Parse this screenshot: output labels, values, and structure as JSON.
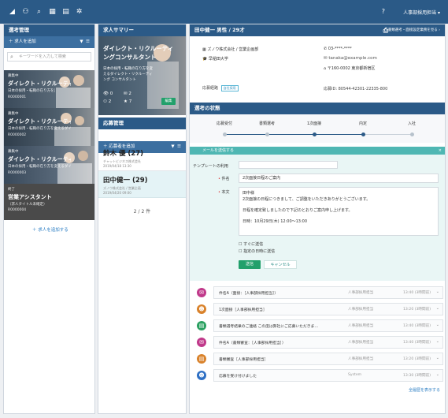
{
  "topbar": {
    "help_icon": "?",
    "user": "人事部採用担当 ▾"
  },
  "col1": {
    "title": "選考管理",
    "add_label": "＋ 求人を追加",
    "search_placeholder": "キーワードを入力して検索",
    "cards": [
      {
        "tag": "募集中",
        "title": "ダイレクト・リクルーティング",
        "sub": "日本の採用・転職の在り方を変える",
        "id": "R0000001"
      },
      {
        "tag": "募集中",
        "title": "ダイレクト・リクルーティング",
        "sub": "日本の採用・転職の在り方を変えるダイレクト",
        "id": "R0000002"
      },
      {
        "tag": "募集中",
        "title": "ダイレクト・リクルーティング",
        "sub": "日本の採用・転職の在り方を変えるダイレクト",
        "id": "R0000003"
      },
      {
        "tag": "終了",
        "title": "営業アシスタント",
        "sub": "（求人タイトル未確定）",
        "id": "R0000004"
      }
    ],
    "add_job_link": "＋ 求人を追加する"
  },
  "col2": {
    "title": "求人サマリー",
    "hero_title": "ダイレクト・リクルーティングコンサルタント",
    "hero_sub": "日本の採用・転職の在り方を変えるダイレクト・リクルーティング コンサルタント",
    "stats": [
      "0",
      "2",
      "2",
      "7"
    ],
    "edit_btn": "編集",
    "applicants_title": "応募管理",
    "add_applicant": "＋ 応募者を追加",
    "applicants": [
      {
        "name": "鈴木 優 (27)",
        "sub1": "チャットビジネス株式会社",
        "sub2": "2019/04/18 13:30"
      },
      {
        "name": "田中健一 (29)",
        "sub1": "ズノウ株式会社 / 営業企画",
        "sub2": "2019/04/20 09:00"
      }
    ],
    "pager": "2 / 2 件"
  },
  "col3": {
    "header_title": "田中健一 男性 / 29才",
    "header_link": "書類選考・面接設定業務を見る ›",
    "company": "ズノウ株式会社 / 営業企画部",
    "school": "早稲田大学",
    "phone": "03-****-****",
    "email": "tanaka@example.com",
    "address": "〒160-0002 東京都新宿区",
    "source_label": "応募経路",
    "source_value": "自社採用",
    "app_id": "応募ID: 80544-42301-22335-800",
    "status_title": "選考の状態",
    "steps": [
      "応募受付",
      "書類選考",
      "1次面接",
      "内定",
      "入社"
    ],
    "mail_title": "メールを送信する",
    "template_label": "テンプレートの利用",
    "subject_label": "件名",
    "subject_value": "2次面接日程のご案内",
    "body_label": "本文",
    "body_lines": [
      "田中様",
      "2次面接の日程につきまして、ご調整をいただきありがとうございます。",
      "",
      "日程を確定致しましたので下記のとおりご案内申し上げます。",
      "",
      "日時：10月29日(木) 12:00〜13:00"
    ],
    "check1": "すぐに送信",
    "check2": "指定の日時に送信",
    "send_btn": "送信",
    "cancel_btn": "キャンセル",
    "history": [
      {
        "icon": "mail",
        "color": "#c0398a",
        "title": "件名A（面接：［人事部採用担当］）",
        "who": "人事部採用担当",
        "when": "13:40 (3時間前)"
      },
      {
        "icon": "person",
        "color": "#d9822b",
        "title": "1次面接［人事部採用担当］",
        "who": "人事部採用担当",
        "when": "13:20 (3時間前)"
      },
      {
        "icon": "doc",
        "color": "#2aa060",
        "title": "書類選考結果のご連絡 この度は弊社にご応募いただきま…",
        "who": "人事部採用担当",
        "when": "13:40 (3時間前)"
      },
      {
        "icon": "mail",
        "color": "#c0398a",
        "title": "件名A（書類審査：［人事部採用担当］）",
        "who": "人事部採用担当",
        "when": "13:40 (3時間前)"
      },
      {
        "icon": "doc",
        "color": "#d9822b",
        "title": "書類審査［人事部採用担当］",
        "who": "人事部採用担当",
        "when": "13:20 (3時間前)"
      },
      {
        "icon": "person",
        "color": "#2e6fc4",
        "title": "応募を受け付けました",
        "who": "System",
        "when": "13:30 (3時間前)"
      }
    ],
    "show_all": "全履歴を表示する"
  }
}
